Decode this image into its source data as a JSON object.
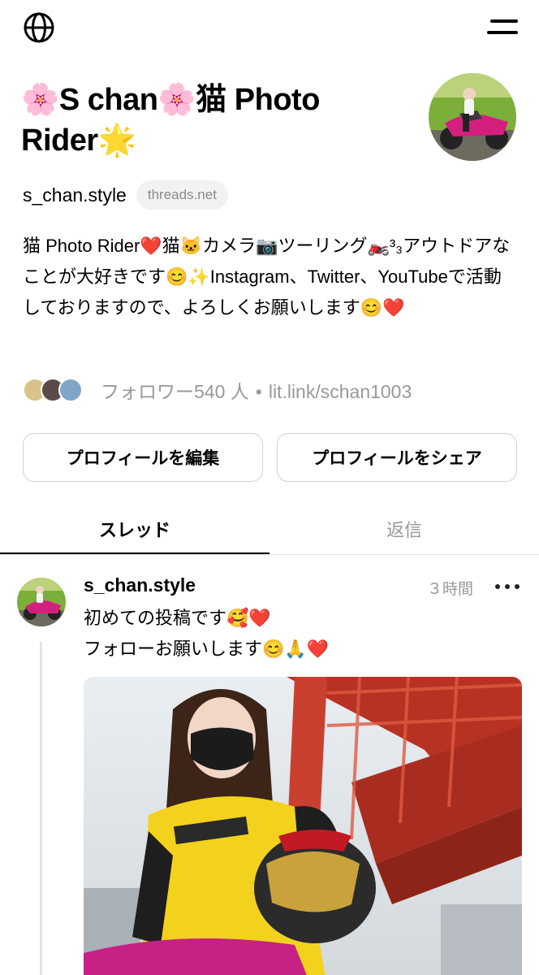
{
  "topbar": {
    "globe_icon": "globe-icon",
    "menu_icon": "menu-icon"
  },
  "profile": {
    "title_line1": "🌸S chan🌸猫 Photo",
    "title_line2": "Rider🌟",
    "handle": "s_chan.style",
    "domain_badge": "threads.net",
    "bio": "猫 Photo Rider❤️猫🐱カメラ📷ツーリング🏍️³₃アウトドアなことが大好きです😊✨Instagram、Twitter、YouTubeで活動しておりますので、よろしくお願いします😊❤️",
    "followers": "フォロワー540 人",
    "link": "lit.link/schan1003"
  },
  "buttons": {
    "edit": "プロフィールを編集",
    "share": "プロフィールをシェア"
  },
  "tabs": {
    "threads": "スレッド",
    "replies": "返信"
  },
  "post": {
    "username": "s_chan.style",
    "time": "３時間",
    "line1": "初めての投稿です🥰❤️",
    "line2": "フォローお願いします😊🙏❤️"
  },
  "colors": {
    "accent_pink": "#e0208a",
    "muted": "#999999",
    "badge_bg": "#f2f2f2"
  }
}
